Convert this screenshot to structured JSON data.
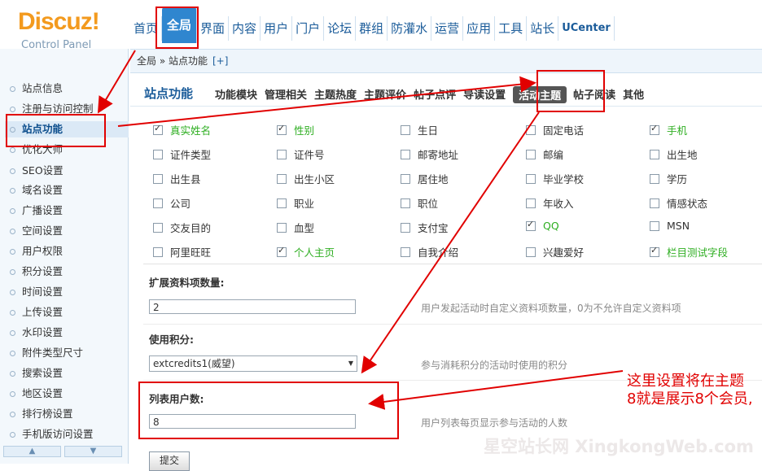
{
  "logo": {
    "main": "Discuz!",
    "sub": "Control Panel"
  },
  "topnav": [
    {
      "label": "首页"
    },
    {
      "label": "全局",
      "active": true
    },
    {
      "label": "界面"
    },
    {
      "label": "内容"
    },
    {
      "label": "用户"
    },
    {
      "label": "门户"
    },
    {
      "label": "论坛"
    },
    {
      "label": "群组"
    },
    {
      "label": "防灌水"
    },
    {
      "label": "运营"
    },
    {
      "label": "应用"
    },
    {
      "label": "工具"
    },
    {
      "label": "站长"
    },
    {
      "label": "UCenter"
    }
  ],
  "breadcrumb": {
    "path": "全局 » 站点功能",
    "plus": "[+]"
  },
  "sidebar": [
    "站点信息",
    "注册与访问控制",
    "站点功能",
    "优化大师",
    "SEO设置",
    "域名设置",
    "广播设置",
    "空间设置",
    "用户权限",
    "积分设置",
    "时间设置",
    "上传设置",
    "水印设置",
    "附件类型尺寸",
    "搜索设置",
    "地区设置",
    "排行榜设置",
    "手机版访问设置"
  ],
  "sidebar_active": "站点功能",
  "main": {
    "title": "站点功能",
    "subnav": [
      "功能模块",
      "管理相关",
      "主题热度",
      "主题评价",
      "帖子点评",
      "导读设置",
      "活动主题",
      "帖子阅读",
      "其他"
    ],
    "subnav_active": "活动主题"
  },
  "profile_fields": [
    [
      {
        "label": "真实姓名",
        "checked": true
      },
      {
        "label": "性别",
        "checked": true
      },
      {
        "label": "生日",
        "checked": false
      },
      {
        "label": "固定电话",
        "checked": false
      },
      {
        "label": "手机",
        "checked": true
      }
    ],
    [
      {
        "label": "证件类型",
        "checked": false
      },
      {
        "label": "证件号",
        "checked": false
      },
      {
        "label": "邮寄地址",
        "checked": false
      },
      {
        "label": "邮编",
        "checked": false
      },
      {
        "label": "出生地",
        "checked": false
      }
    ],
    [
      {
        "label": "出生县",
        "checked": false
      },
      {
        "label": "出生小区",
        "checked": false
      },
      {
        "label": "居住地",
        "checked": false
      },
      {
        "label": "毕业学校",
        "checked": false
      },
      {
        "label": "学历",
        "checked": false
      }
    ],
    [
      {
        "label": "公司",
        "checked": false
      },
      {
        "label": "职业",
        "checked": false
      },
      {
        "label": "职位",
        "checked": false
      },
      {
        "label": "年收入",
        "checked": false
      },
      {
        "label": "情感状态",
        "checked": false
      }
    ],
    [
      {
        "label": "交友目的",
        "checked": false
      },
      {
        "label": "血型",
        "checked": false
      },
      {
        "label": "支付宝",
        "checked": false
      },
      {
        "label": "QQ",
        "checked": true
      },
      {
        "label": "MSN",
        "checked": false
      }
    ],
    [
      {
        "label": "阿里旺旺",
        "checked": false
      },
      {
        "label": "个人主页",
        "checked": true
      },
      {
        "label": "自我介绍",
        "checked": false
      },
      {
        "label": "兴趣爱好",
        "checked": false
      },
      {
        "label": "栏目测试字段",
        "checked": true
      }
    ]
  ],
  "form": {
    "ext_label": "扩展资料项数量:",
    "ext_value": "2",
    "ext_tip": "用户发起活动时自定义资料项数量，0为不允许自定义资料项",
    "credit_label": "使用积分:",
    "credit_value": "extcredits1(威望)",
    "credit_tip": "参与消耗积分的活动时使用的积分",
    "list_label": "列表用户数:",
    "list_value": "8",
    "list_tip": "用户列表每页显示参与活动的人数",
    "submit": "提交"
  },
  "annotation": {
    "line1": "这里设置将在主题",
    "line2": "8就是展示8个会员,"
  },
  "watermark": "星空站长网 XingkongWeb.com",
  "colors": {
    "accent": "#2f86cf",
    "checked_label": "#2eae21",
    "annotation": "#e10000"
  }
}
